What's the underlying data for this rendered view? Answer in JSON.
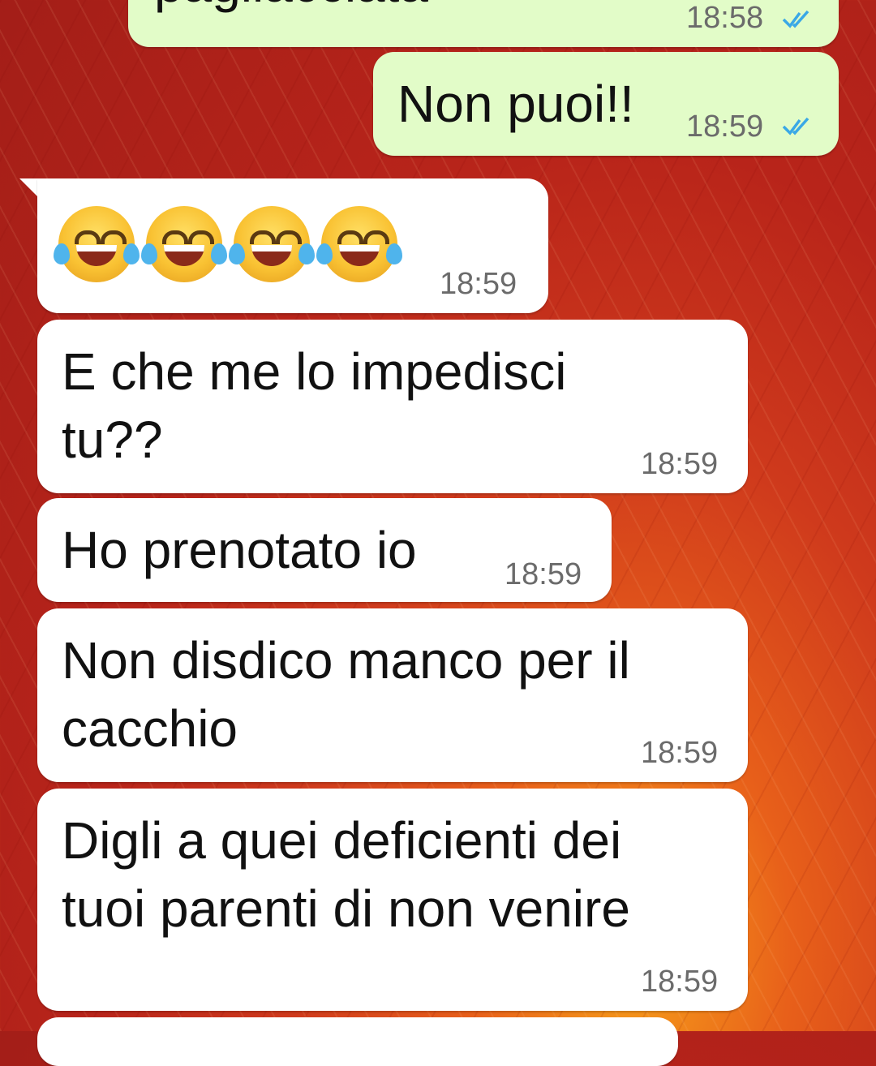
{
  "colors": {
    "outgoing_bubble": "#e2fcc8",
    "incoming_bubble": "#ffffff",
    "read_ticks": "#3aa8e6",
    "background_accent": "#c62a1c"
  },
  "messages": [
    {
      "direction": "out",
      "text": "pagliacciata",
      "time": "18:58",
      "status": "read"
    },
    {
      "direction": "out",
      "text": "Non puoi!!",
      "time": "18:59",
      "status": "read"
    },
    {
      "direction": "in",
      "emoji": [
        "face-with-tears-of-joy",
        "face-with-tears-of-joy",
        "face-with-tears-of-joy",
        "face-with-tears-of-joy"
      ],
      "time": "18:59"
    },
    {
      "direction": "in",
      "text": "E che me lo impedisci\ntu??",
      "time": "18:59"
    },
    {
      "direction": "in",
      "text": "Ho prenotato io",
      "time": "18:59"
    },
    {
      "direction": "in",
      "text": "Non disdico manco per il\ncacchio",
      "time": "18:59"
    },
    {
      "direction": "in",
      "text": "Digli a quei deficienti dei\ntuoi parenti di non venire",
      "time": "18:59"
    }
  ]
}
